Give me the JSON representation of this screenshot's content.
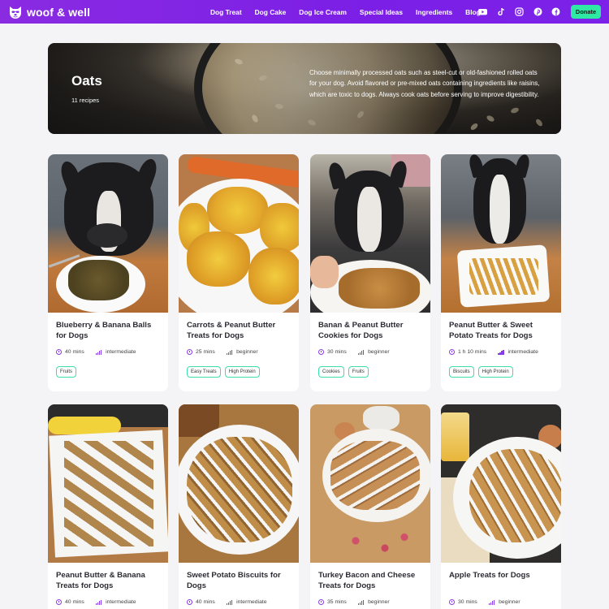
{
  "brand": {
    "name": "woof & well"
  },
  "nav": {
    "items": [
      "Dog Treat",
      "Dog Cake",
      "Dog Ice Cream",
      "Special Ideas",
      "Ingredients",
      "Blog"
    ],
    "social_icons": [
      "youtube-icon",
      "tiktok-icon",
      "instagram-icon",
      "pinterest-icon",
      "facebook-icon"
    ],
    "donate_label": "Donate"
  },
  "hero": {
    "title": "Oats",
    "count": "11 recipes",
    "description": "Choose minimally processed oats such as steel-cut or old-fashioned rolled oats for your dog. Avoid flavored or pre-mixed oats containing ingredients like raisins, which are toxic to dogs. Always cook oats before serving to improve digestibility."
  },
  "recipes": [
    {
      "title": "Blueberry & Banana Balls for Dogs",
      "time": "40 mins",
      "level": "intermediate",
      "tags": [
        "Fruits"
      ]
    },
    {
      "title": "Carrots & Peanut Butter Treats for Dogs",
      "time": "25 mins",
      "level": "beginner",
      "tags": [
        "Easy Treats",
        "High Protein"
      ]
    },
    {
      "title": "Banan & Peanut Butter Cookies for Dogs",
      "time": "30 mins",
      "level": "beginner",
      "tags": [
        "Cookies",
        "Fruits"
      ]
    },
    {
      "title": "Peanut Butter & Sweet Potato Treats for Dogs",
      "time": "1 h 10 mins",
      "level": "intermediate",
      "tags": [
        "Biscuits",
        "High Protein"
      ]
    },
    {
      "title": "Peanut Butter & Banana Treats for Dogs",
      "time": "40 mins",
      "level": "intermediate",
      "tags": []
    },
    {
      "title": "Sweet Potato Biscuits for Dogs",
      "time": "40 mins",
      "level": "intermediate",
      "tags": []
    },
    {
      "title": "Turkey Bacon and Cheese Treats for Dogs",
      "time": "35 mins",
      "level": "beginner",
      "tags": []
    },
    {
      "title": "Apple Treats for Dogs",
      "time": "30 mins",
      "level": "beginner",
      "tags": []
    }
  ],
  "colors": {
    "brand_purple": "#7b1fe6",
    "donate_green": "#2ee8a3",
    "tag_border": "#3ddfa6",
    "icon_purple": "#8a3be8"
  }
}
